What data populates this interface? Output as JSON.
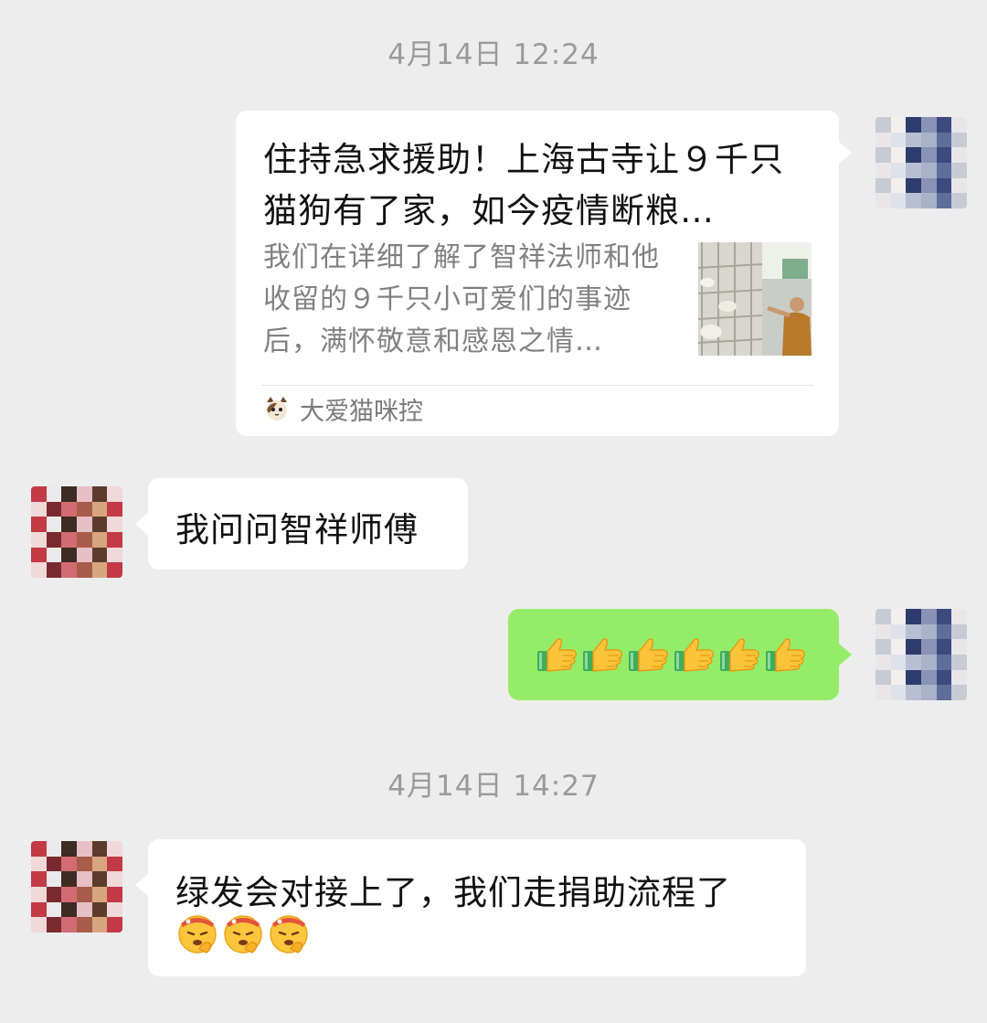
{
  "timestamps": [
    "4月14日 12:24",
    "4月14日 14:27"
  ],
  "messages": {
    "shared_card": {
      "title": "住持急求援助！上海古寺让９千只猫狗有了家，如今疫情断粮…",
      "description": "我们在详细了解了智祥法师和他收留的９千只小可爱们的事迹后，满怀敬意和感恩之情…",
      "source": "大爱猫咪控",
      "source_icon": "cat-face-icon",
      "thumbnail": "monk-feeding-cats-photo"
    },
    "reply_1": "我问问智祥师傅",
    "thumbs_up": {
      "emoji": "thumbs-up-emoji",
      "count": 6
    },
    "reply_2": {
      "text": "绿发会对接上了，我们走捐助流程了",
      "emoji": "salute-face-emoji",
      "emoji_count": 3
    }
  },
  "colors": {
    "background": "#ededed",
    "bubble_self": "#95ec69",
    "bubble_other": "#ffffff",
    "timestamp": "#9a9a9a"
  }
}
